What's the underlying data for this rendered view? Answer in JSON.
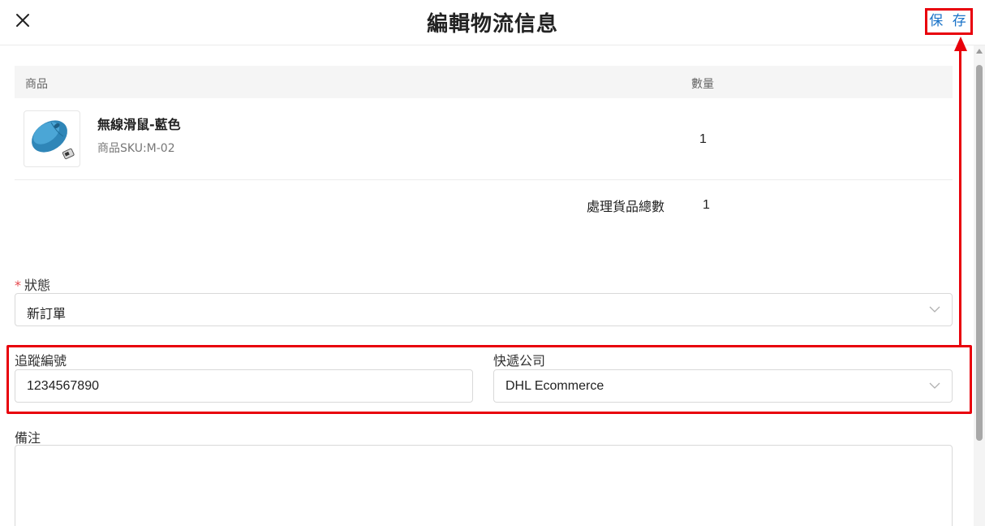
{
  "header": {
    "title": "編輯物流信息",
    "save_label": "保 存",
    "close_icon": "close-icon"
  },
  "table": {
    "columns": [
      "商品",
      "數量"
    ],
    "rows": [
      {
        "name": "無線滑鼠-藍色",
        "sku": "商品SKU:M-02",
        "quantity": "1",
        "image": "blue-wireless-mouse"
      }
    ],
    "total_label": "處理貨品總數",
    "total_value": "1"
  },
  "form": {
    "status": {
      "label": "狀態",
      "required_mark": "*",
      "value": "新訂單"
    },
    "tracking": {
      "label": "追蹤編號",
      "value": "1234567890"
    },
    "courier": {
      "label": "快遞公司",
      "value": "DHL Ecommerce"
    },
    "note": {
      "label": "備注",
      "value": ""
    }
  },
  "colors": {
    "accent": "#1a73c8",
    "annotation": "#e8000b",
    "required": "#e5484d"
  }
}
